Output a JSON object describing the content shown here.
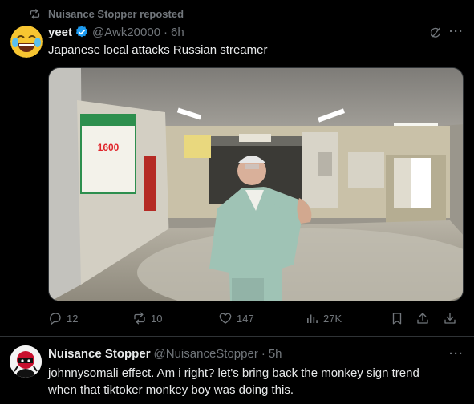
{
  "repost_banner": {
    "label": "Nuisance Stopper reposted",
    "icon": "repost-icon"
  },
  "tweet": {
    "author_name": "yeet",
    "handle": "@Awk20000",
    "separator": "·",
    "time": "6h",
    "avatar": "laughing-emoji-avatar",
    "verified": true,
    "text": "Japanese local attacks Russian streamer",
    "more_label": "···",
    "media_sign_price": "1600",
    "actions": {
      "replies": "12",
      "reposts": "10",
      "likes": "147",
      "views": "27K"
    }
  },
  "reply": {
    "author_name": "Nuisance Stopper",
    "handle": "@NuisanceStopper",
    "separator": "·",
    "time": "5h",
    "avatar": "ninja-avatar",
    "more_label": "···",
    "text": "johnnysomali effect. Am i right? let's bring back the monkey sign trend when that tiktoker monkey boy was doing this."
  },
  "colors": {
    "background": "#000000",
    "text": "#e7e9ea",
    "muted": "#71767b",
    "verified": "#1d9bf0",
    "divider": "#2f3336"
  }
}
